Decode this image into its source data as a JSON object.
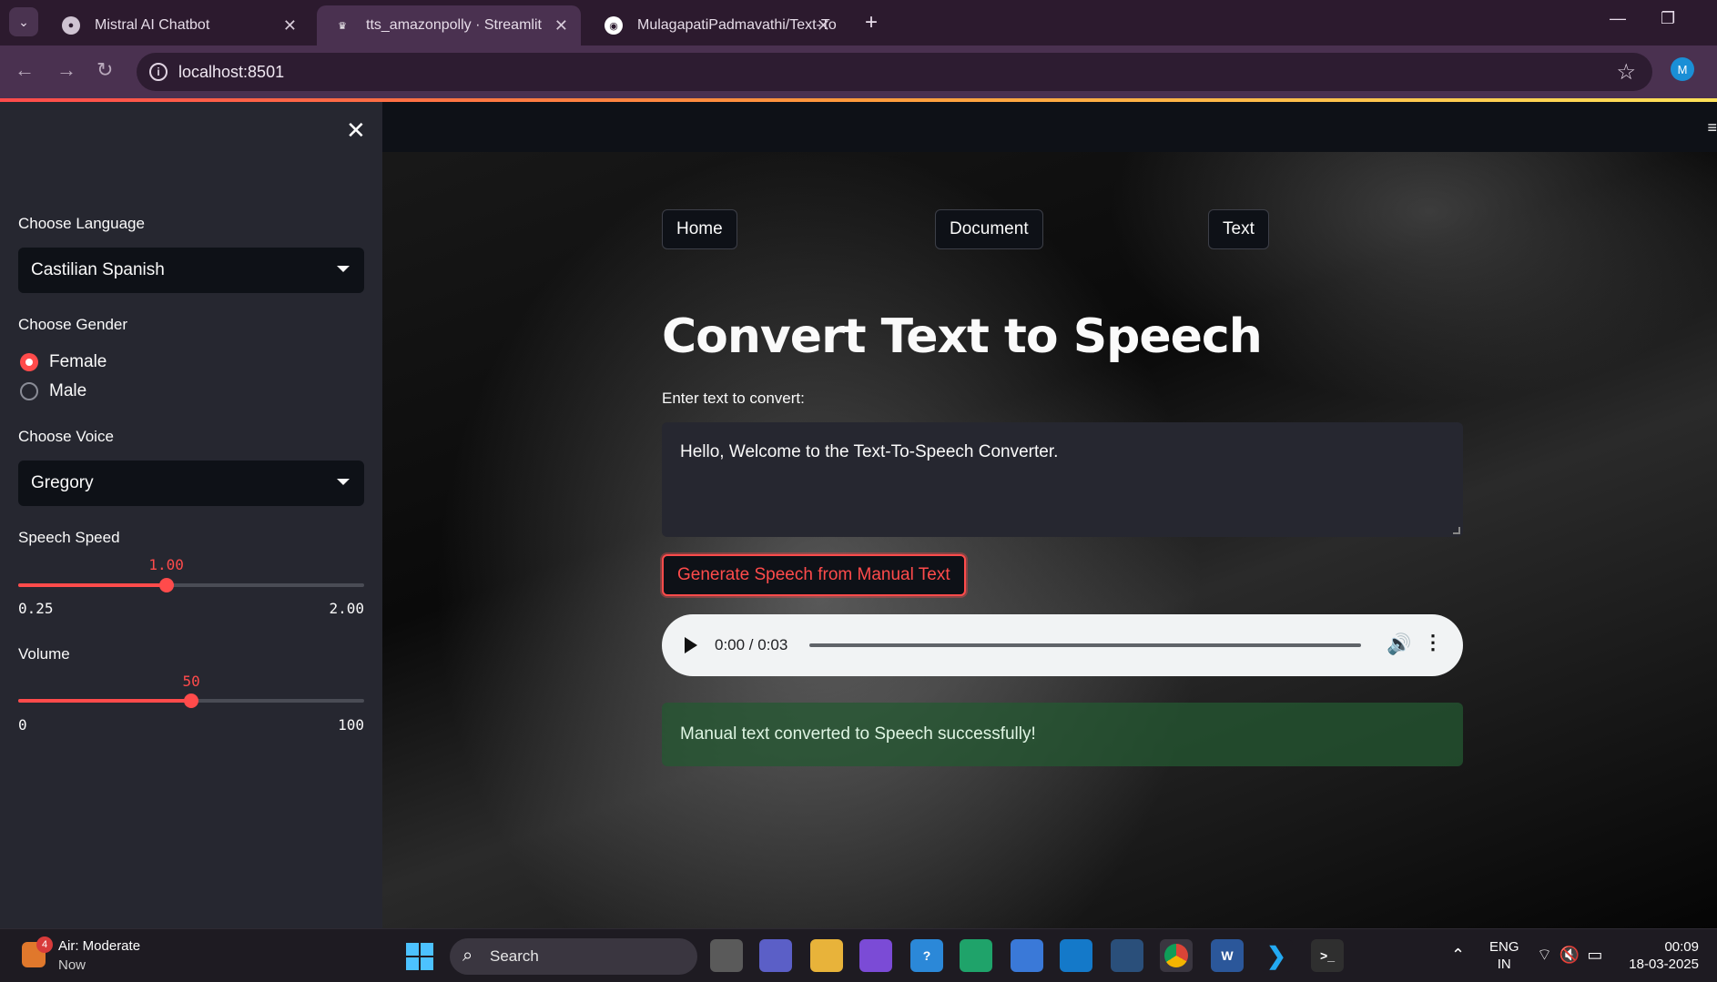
{
  "browser": {
    "tabs": [
      {
        "title": "Mistral AI Chatbot",
        "icon": "globe-icon"
      },
      {
        "title": "tts_amazonpolly · Streamlit",
        "icon": "streamlit-crown-icon"
      },
      {
        "title": "MulagapatiPadmavathi/Text-To",
        "icon": "github-icon"
      }
    ],
    "url": "localhost:8501",
    "profile_initial": "M"
  },
  "sidebar": {
    "language_label": "Choose Language",
    "language_value": "Castilian Spanish",
    "gender_label": "Choose Gender",
    "gender_options": [
      "Female",
      "Male"
    ],
    "gender_selected": "Female",
    "voice_label": "Choose Voice",
    "voice_value": "Gregory",
    "speed": {
      "label": "Speech Speed",
      "value": "1.00",
      "min": "0.25",
      "max": "2.00",
      "fraction": 0.4286
    },
    "volume": {
      "label": "Volume",
      "value": "50",
      "min": "0",
      "max": "100",
      "fraction": 0.5
    }
  },
  "main": {
    "nav": [
      "Home",
      "Document",
      "Text"
    ],
    "title": "Convert Text to Speech",
    "input_label": "Enter text to convert:",
    "input_value": "Hello, Welcome to the Text-To-Speech Converter.",
    "generate_button": "Generate Speech from Manual Text",
    "audio": {
      "time": "0:00 / 0:03"
    },
    "success_message": "Manual text converted to Speech successfully!"
  },
  "taskbar": {
    "weather_title": "Air: Moderate",
    "weather_sub": "Now",
    "weather_badge": "4",
    "search_label": "Search",
    "lang_line1": "ENG",
    "lang_line2": "IN",
    "time": "00:09",
    "date": "18-03-2025"
  },
  "colors": {
    "accent": "#ff4b4b",
    "sidebar_bg": "#262730",
    "success_bg": "#245832"
  }
}
